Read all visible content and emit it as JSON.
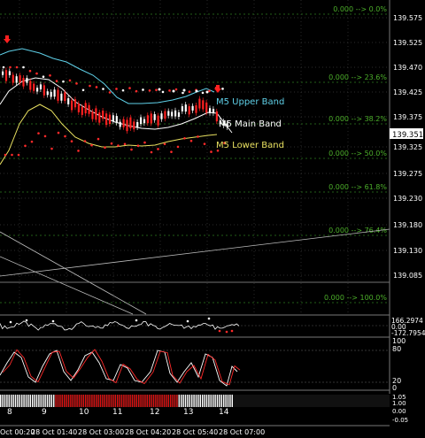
{
  "colors": {
    "background": "#000000",
    "grid": "#3a3a3a",
    "fib": "#2e7d1f",
    "fib_text": "#4caf2a",
    "upper_band": "#5fd0e8",
    "main_band": "#ffffff",
    "lower_band": "#e8e060",
    "candle_bear": "#ff2020",
    "candle_bull": "#ffffff",
    "dot": "#ff2a2a",
    "dot_white": "#ffffff",
    "price_tag_bg": "#ffffff",
    "price_tag_text": "#000000",
    "stoch_main": "#ffffff",
    "stoch_signal": "#ff2a2a",
    "bar_red": "#dd1111",
    "bar_white": "#ffffff"
  },
  "price_axis": {
    "labels": [
      "139.575",
      "139.525",
      "139.470",
      "139.425",
      "139.375",
      "139.325",
      "139.275",
      "139.230",
      "139.180",
      "139.130",
      "139.085"
    ],
    "current_price": "139.351"
  },
  "fib_levels": [
    {
      "label": "0.000 --> 0.0%"
    },
    {
      "label": "0.000 --> 23.6%"
    },
    {
      "label": "0.000 --> 38.2%"
    },
    {
      "label": "0.000 --> 50.0%"
    },
    {
      "label": "0.000 --> 61.8%"
    },
    {
      "label": "0.000 --> 76.4%"
    },
    {
      "label": "0.000 --> 100.0%"
    }
  ],
  "band_labels": {
    "upper": "M5 Upper Band",
    "main": "M5 Main Band",
    "lower": "M5 Lower Band"
  },
  "cci_panel": {
    "label_high": "166.2974",
    "label_low": "-172.7954",
    "label_zero": "0.00"
  },
  "stoch_panel": {
    "labels": [
      "100",
      "80",
      "20",
      "0"
    ]
  },
  "bar_panel": {
    "labels": [
      "1.05",
      "1.00",
      "0.00",
      "-0.05"
    ]
  },
  "hour_labels": [
    "8",
    "9",
    "10",
    "11",
    "12",
    "13",
    "14"
  ],
  "time_axis": {
    "labels": [
      "Oct 00:20",
      "28 Oct 01:40",
      "28 Oct 03:00",
      "28 Oct 04:20",
      "28 Oct 05:40",
      "28 Oct 07:00"
    ]
  }
}
